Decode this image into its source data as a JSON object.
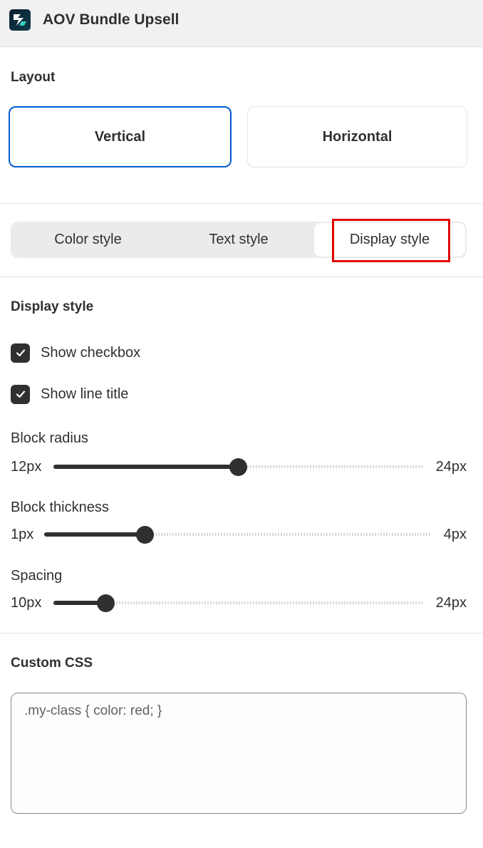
{
  "header": {
    "title": "AOV Bundle Upsell",
    "icon": "app-logo-icon"
  },
  "layout": {
    "title": "Layout",
    "options": [
      {
        "label": "Vertical",
        "selected": true
      },
      {
        "label": "Horizontal",
        "selected": false
      }
    ]
  },
  "tabs": [
    {
      "label": "Color style",
      "active": false
    },
    {
      "label": "Text style",
      "active": false
    },
    {
      "label": "Display style",
      "active": true
    }
  ],
  "display": {
    "title": "Display style",
    "checkboxes": [
      {
        "label": "Show checkbox",
        "checked": true
      },
      {
        "label": "Show line title",
        "checked": true
      }
    ],
    "sliders": [
      {
        "label": "Block radius",
        "min_label": "12px",
        "max_label": "24px",
        "fraction": 0.5
      },
      {
        "label": "Block thickness",
        "min_label": "1px",
        "max_label": "4px",
        "fraction": 0.26
      },
      {
        "label": "Spacing",
        "min_label": "10px",
        "max_label": "24px",
        "fraction": 0.14
      }
    ]
  },
  "custom_css": {
    "title": "Custom CSS",
    "placeholder": ".my-class { color: red; }",
    "value": ""
  },
  "colors": {
    "accent": "#005bd3",
    "highlight": "#e00000",
    "dark": "#303030"
  }
}
